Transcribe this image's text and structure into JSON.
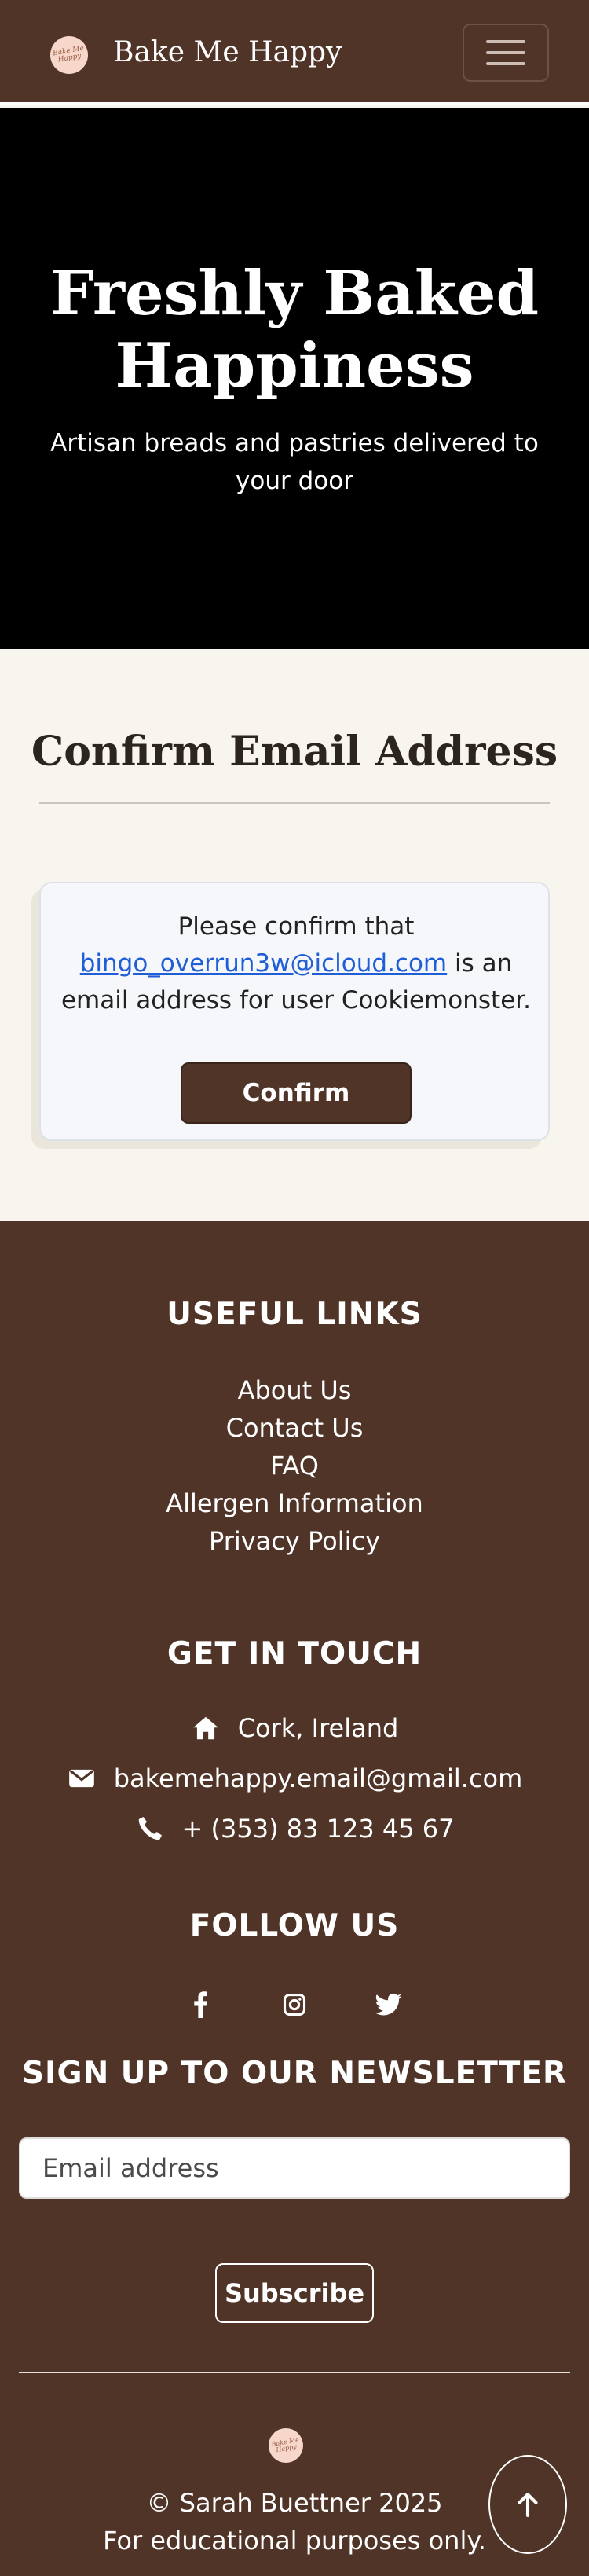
{
  "navbar": {
    "logo_text": "Bake Me Happy",
    "brand": "Bake Me Happy"
  },
  "hero": {
    "title": "Freshly Baked Happiness",
    "subtitle": "Artisan breads and pastries delivered to your door"
  },
  "main": {
    "page_title": "Confirm Email Address",
    "card": {
      "text_before": "Please confirm that ",
      "email": "bingo_overrun3w@icloud.com",
      "text_after": " is an email address for user Cookiemonster.",
      "button_label": "Confirm"
    }
  },
  "footer": {
    "useful_links_heading": "USEFUL LINKS",
    "links": [
      "About Us",
      "Contact Us",
      "FAQ",
      "Allergen Information",
      "Privacy Policy"
    ],
    "get_in_touch_heading": "GET IN TOUCH",
    "contact": {
      "location": "Cork, Ireland",
      "email": "bakemehappy.email@gmail.com",
      "phone": "+ (353) 83 123 45 67"
    },
    "follow_heading": "FOLLOW US",
    "social_icons": [
      "facebook-icon",
      "instagram-icon",
      "twitter-icon"
    ],
    "newsletter_heading": "SIGN UP TO OUR NEWSLETTER",
    "newsletter_placeholder": "Email address",
    "subscribe_label": "Subscribe",
    "logo_text": "Bake Me Happy",
    "copyright": "© Sarah Buettner 2025",
    "disclaimer": "For educational purposes only.",
    "back_to_top_icon": "arrow-up-icon"
  },
  "colors": {
    "brand_brown": "#4f3427",
    "page_background": "#f8f4ee",
    "link_blue": "#1f5ed6"
  }
}
